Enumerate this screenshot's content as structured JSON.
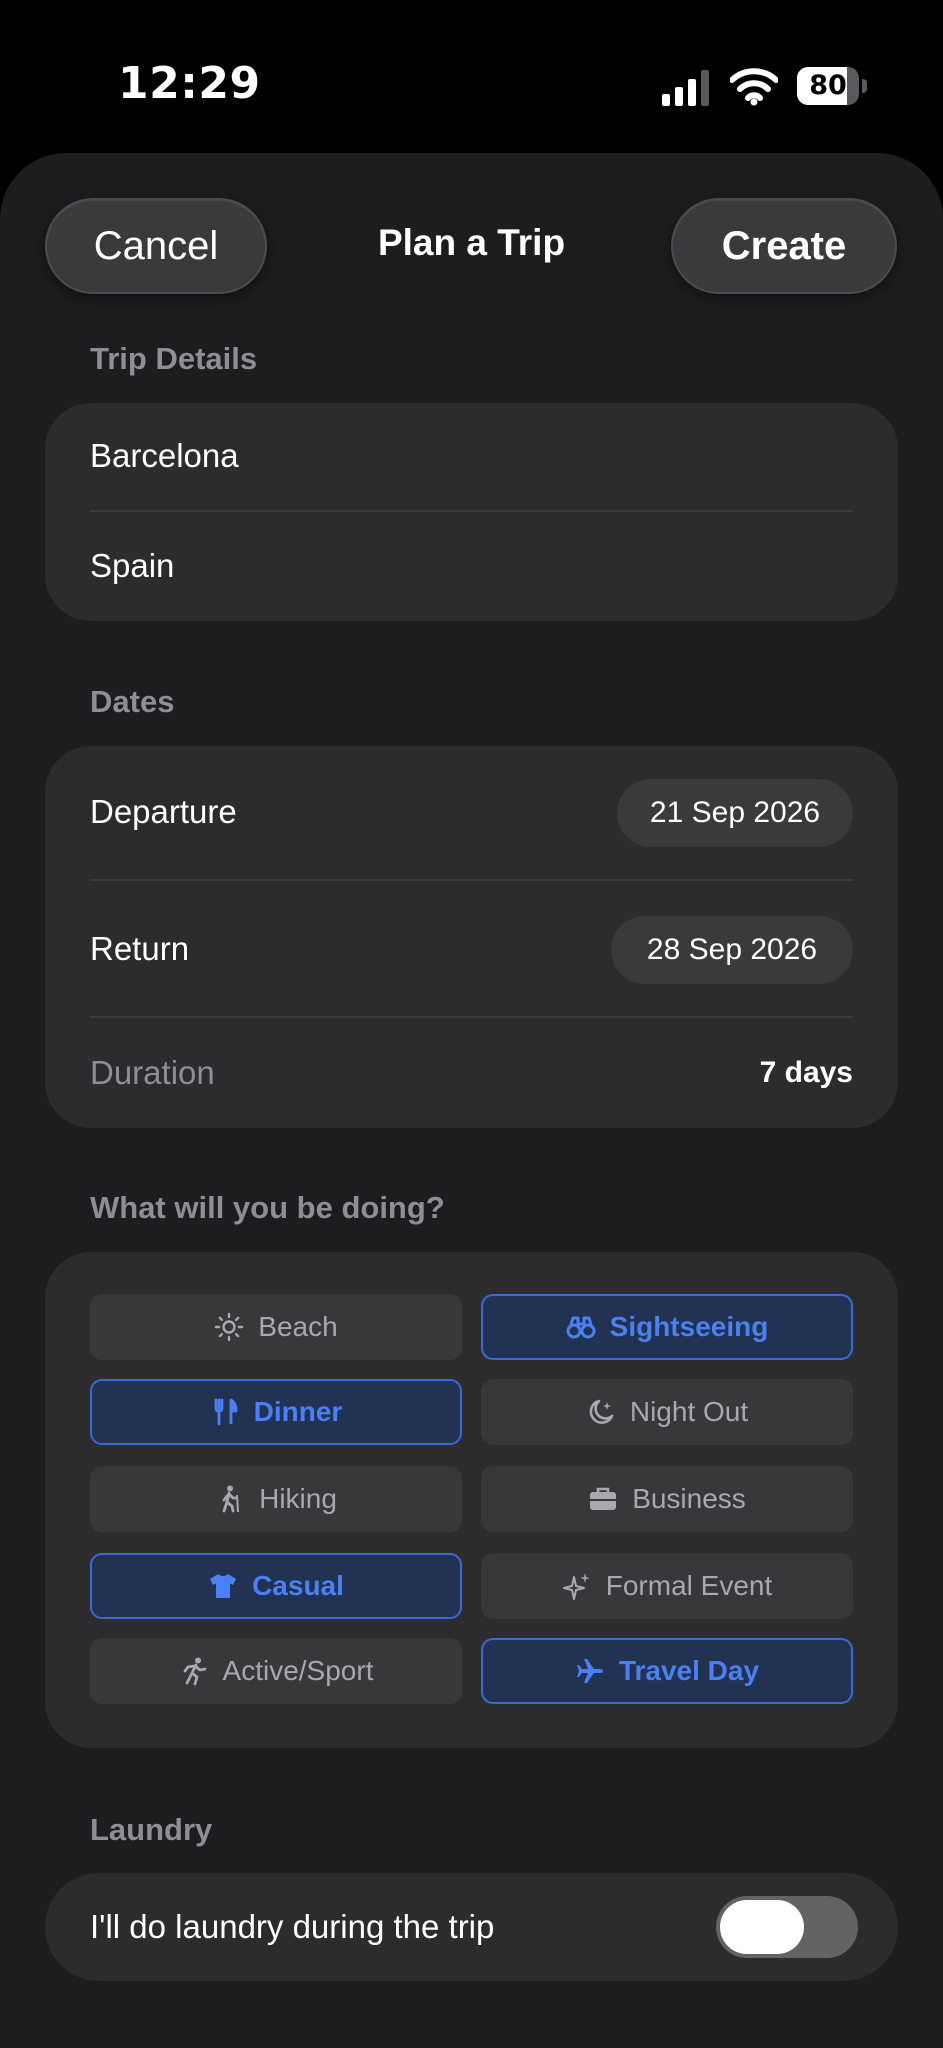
{
  "status_bar": {
    "time": "12:29",
    "battery_percent": "80",
    "battery_level": 0.8
  },
  "nav": {
    "cancel_label": "Cancel",
    "title": "Plan a Trip",
    "create_label": "Create"
  },
  "trip_details": {
    "header": "Trip Details",
    "city": "Barcelona",
    "country": "Spain"
  },
  "dates": {
    "header": "Dates",
    "departure_label": "Departure",
    "departure_value": "21 Sep 2026",
    "return_label": "Return",
    "return_value": "28 Sep 2026",
    "duration_label": "Duration",
    "duration_value": "7 days"
  },
  "activities": {
    "header": "What will you be doing?",
    "items": [
      {
        "label": "Beach",
        "icon": "sun-icon",
        "selected": false
      },
      {
        "label": "Sightseeing",
        "icon": "binoculars-icon",
        "selected": true
      },
      {
        "label": "Dinner",
        "icon": "fork-knife-icon",
        "selected": true
      },
      {
        "label": "Night Out",
        "icon": "moon-stars-icon",
        "selected": false
      },
      {
        "label": "Hiking",
        "icon": "hiker-icon",
        "selected": false
      },
      {
        "label": "Business",
        "icon": "briefcase-icon",
        "selected": false
      },
      {
        "label": "Casual",
        "icon": "tshirt-icon",
        "selected": true
      },
      {
        "label": "Formal Event",
        "icon": "sparkles-icon",
        "selected": false
      },
      {
        "label": "Active/Sport",
        "icon": "runner-icon",
        "selected": false
      },
      {
        "label": "Travel Day",
        "icon": "airplane-icon",
        "selected": true
      }
    ]
  },
  "laundry": {
    "header": "Laundry",
    "label": "I'll do laundry during the trip",
    "enabled": false
  },
  "colors": {
    "accent": "#4a80f2",
    "background": "#1d1d1f",
    "card": "#2c2c2e"
  }
}
